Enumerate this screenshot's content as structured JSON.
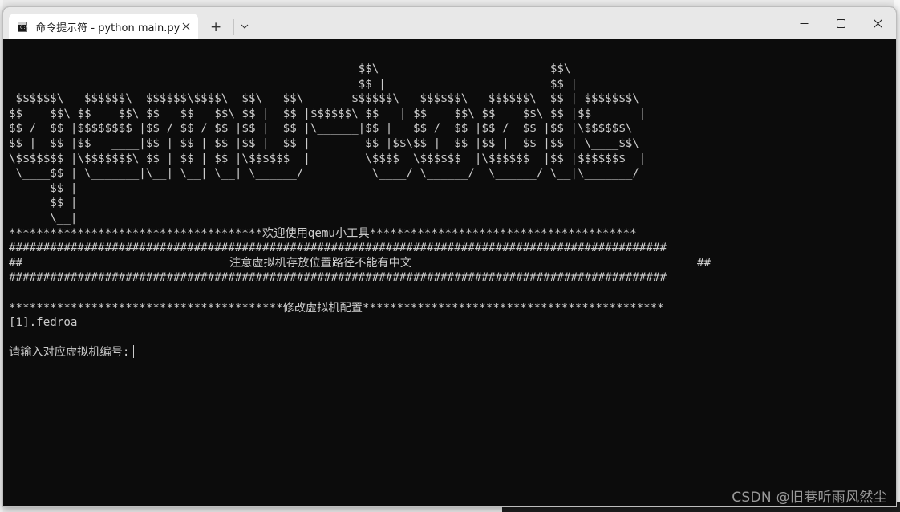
{
  "window": {
    "tab_title": "命令提示符 - python  main.py",
    "tab_icon": "cmd-icon",
    "new_tab_label": "+",
    "minimize_icon": "minimize-icon",
    "maximize_icon": "maximize-icon",
    "close_icon": "close-icon"
  },
  "terminal": {
    "banner": [
      "                                                   $$\\                         $$\\",
      "                                                   $$ |                        $$ |",
      " $$$$$$\\   $$$$$$\\  $$$$$$\\$$$$\\  $$\\   $$\\       $$$$$$\\   $$$$$$\\   $$$$$$\\  $$ | $$$$$$$\\",
      "$$  __$$\\ $$  __$$\\ $$  _$$  _$$\\ $$ |  $$ |$$$$$$\\_$$  _| $$  __$$\\ $$  __$$\\ $$ |$$  _____|",
      "$$ /  $$ |$$$$$$$$ |$$ / $$ / $$ |$$ |  $$ |\\______|$$ |   $$ /  $$ |$$ /  $$ |$$ |\\$$$$$$\\",
      "$$ |  $$ |$$   ____|$$ | $$ | $$ |$$ |  $$ |        $$ |$$\\$$ |  $$ |$$ |  $$ |$$ | \\____$$\\",
      "\\$$$$$$$ |\\$$$$$$$\\ $$ | $$ | $$ |\\$$$$$$  |        \\$$$$  \\$$$$$$  |\\$$$$$$  |$$ |$$$$$$$  |",
      " \\____$$ | \\_______|\\__| \\__| \\__| \\______/          \\____/ \\______/  \\______/ \\__|\\_______/",
      "      $$ |",
      "      $$ |",
      "      \\__|"
    ],
    "welcome_line": "*************************************欢迎使用qemu小工具***************************************",
    "hash_line_1": "################################################################################################",
    "notice_left": "##",
    "notice_text": "注意虚拟机存放位置路径不能有中文",
    "notice_right": "##",
    "hash_line_2": "################################################################################################",
    "modify_line": "****************************************修改虚拟机配置********************************************",
    "vm_item": "[1].fedroa",
    "prompt": "请输入对应虚拟机编号:"
  },
  "watermark": "CSDN @旧巷听雨风然尘"
}
